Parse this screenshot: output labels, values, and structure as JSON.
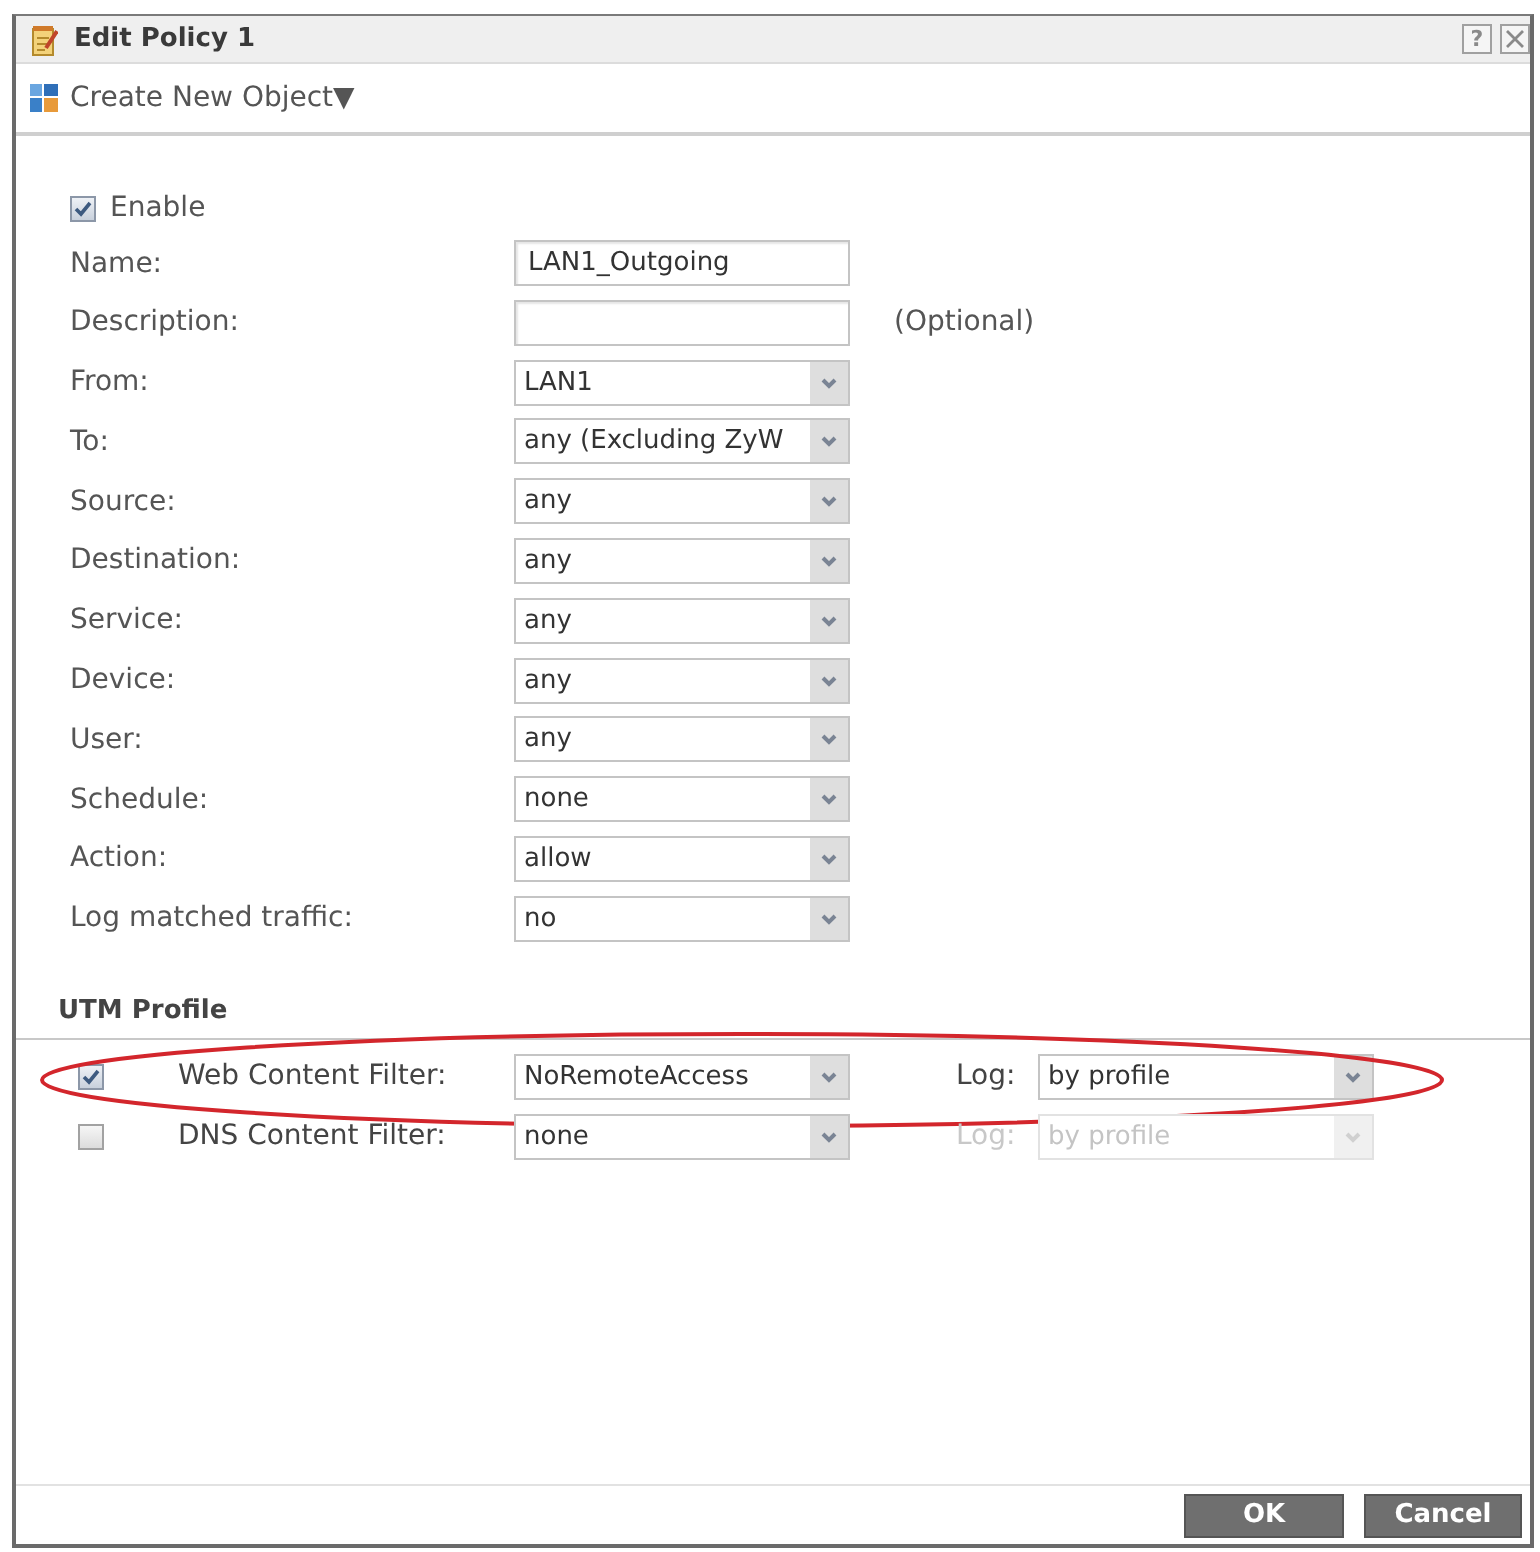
{
  "window": {
    "title": "Edit Policy 1",
    "help": "?"
  },
  "toolbar": {
    "menu": "Create New Object▼"
  },
  "enable": {
    "label": "Enable",
    "checked": true
  },
  "fields": [
    {
      "kind": "text",
      "label": "Name:",
      "value": "LAN1_Outgoing"
    },
    {
      "kind": "text",
      "label": "Description:",
      "note": "(Optional)"
    },
    {
      "kind": "select",
      "label": "From:",
      "value": "LAN1"
    },
    {
      "kind": "select",
      "label": "To:",
      "value": "any (Excluding ZyW"
    },
    {
      "kind": "select",
      "label": "Source:",
      "value": "any"
    },
    {
      "kind": "select",
      "label": "Destination:",
      "value": "any"
    },
    {
      "kind": "select",
      "label": "Service:",
      "value": "any"
    },
    {
      "kind": "select",
      "label": "Device:",
      "value": "any"
    },
    {
      "kind": "select",
      "label": "User:",
      "value": "any"
    },
    {
      "kind": "select",
      "label": "Schedule:",
      "value": "none"
    },
    {
      "kind": "select",
      "label": "Action:",
      "value": "allow"
    },
    {
      "kind": "select",
      "label": "Log matched traffic:",
      "value": "no"
    }
  ],
  "utm_profile": {
    "title": "UTM Profile",
    "rows": [
      {
        "label": "Web Content Filter:",
        "checked": true,
        "profile": "NoRemoteAccess",
        "log_label": "Log:",
        "log": "by profile",
        "log_disabled": false,
        "highlighted": true
      },
      {
        "label": "DNS Content Filter:",
        "checked": false,
        "profile": "none",
        "log_label": "Log:",
        "log": "by profile",
        "log_disabled": true,
        "highlighted": false
      }
    ]
  },
  "buttons": [
    {
      "kind": "ok",
      "label": "OK"
    },
    {
      "kind": "cancel",
      "label": "Cancel"
    }
  ]
}
